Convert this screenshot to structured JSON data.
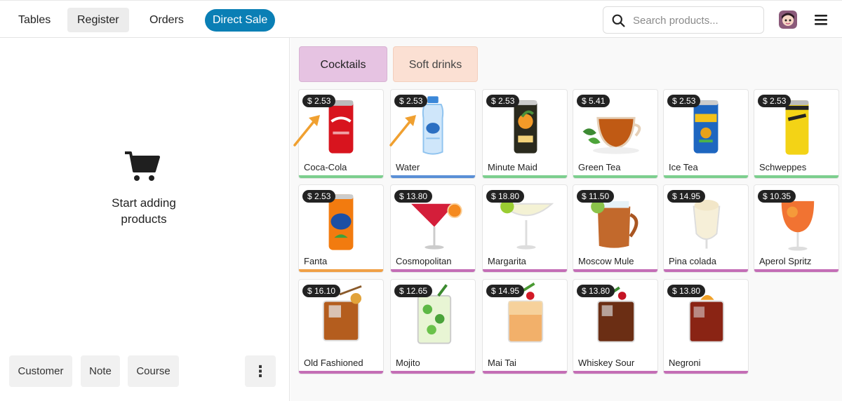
{
  "nav": {
    "tables": "Tables",
    "register": "Register",
    "orders": "Orders",
    "direct_sale": "Direct Sale"
  },
  "search": {
    "placeholder": "Search products..."
  },
  "cart": {
    "empty_line1": "Start adding",
    "empty_line2": "products"
  },
  "footer": {
    "customer": "Customer",
    "note": "Note",
    "course": "Course",
    "more": "⋮"
  },
  "categories": [
    {
      "label": "Cocktails",
      "color": "#e6c3e2"
    },
    {
      "label": "Soft drinks",
      "color": "#fbe0d3"
    }
  ],
  "colors": {
    "accent": "#0a7fb5",
    "bar_green": "#7ccf8e",
    "bar_blue": "#5a8fd6",
    "bar_orange": "#f0a046",
    "bar_purple": "#c46eb6"
  },
  "products": [
    {
      "name": "Coca-Cola",
      "price": "$ 2.53",
      "icon": "coca-cola-can",
      "bar": "#7ccf8e"
    },
    {
      "name": "Water",
      "price": "$ 2.53",
      "icon": "water-bottle",
      "bar": "#5a8fd6"
    },
    {
      "name": "Minute Maid",
      "price": "$ 2.53",
      "icon": "minute-maid-can",
      "bar": "#7ccf8e"
    },
    {
      "name": "Green Tea",
      "price": "$ 5.41",
      "icon": "tea-cup",
      "bar": "#7ccf8e"
    },
    {
      "name": "Ice Tea",
      "price": "$ 2.53",
      "icon": "nestea-can",
      "bar": "#7ccf8e"
    },
    {
      "name": "Schweppes",
      "price": "$ 2.53",
      "icon": "schweppes-can",
      "bar": "#7ccf8e"
    },
    {
      "name": "Fanta",
      "price": "$ 2.53",
      "icon": "fanta-can",
      "bar": "#f0a046"
    },
    {
      "name": "Cosmopolitan",
      "price": "$ 13.80",
      "icon": "cosmopolitan-glass",
      "bar": "#c46eb6"
    },
    {
      "name": "Margarita",
      "price": "$ 18.80",
      "icon": "margarita-glass",
      "bar": "#c46eb6"
    },
    {
      "name": "Moscow Mule",
      "price": "$ 11.50",
      "icon": "copper-mug",
      "bar": "#c46eb6"
    },
    {
      "name": "Pina colada",
      "price": "$ 14.95",
      "icon": "pina-colada-glass",
      "bar": "#c46eb6"
    },
    {
      "name": "Aperol Spritz",
      "price": "$ 10.35",
      "icon": "spritz-glass",
      "bar": "#c46eb6"
    },
    {
      "name": "Old Fashioned",
      "price": "$ 16.10",
      "icon": "rocks-glass",
      "bar": "#c46eb6"
    },
    {
      "name": "Mojito",
      "price": "$ 12.65",
      "icon": "mojito-glass",
      "bar": "#c46eb6"
    },
    {
      "name": "Mai Tai",
      "price": "$ 14.95",
      "icon": "mai-tai-glass",
      "bar": "#c46eb6"
    },
    {
      "name": "Whiskey Sour",
      "price": "$ 13.80",
      "icon": "whiskey-sour-glass",
      "bar": "#c46eb6"
    },
    {
      "name": "Negroni",
      "price": "$ 13.80",
      "icon": "negroni-glass",
      "bar": "#c46eb6"
    }
  ]
}
